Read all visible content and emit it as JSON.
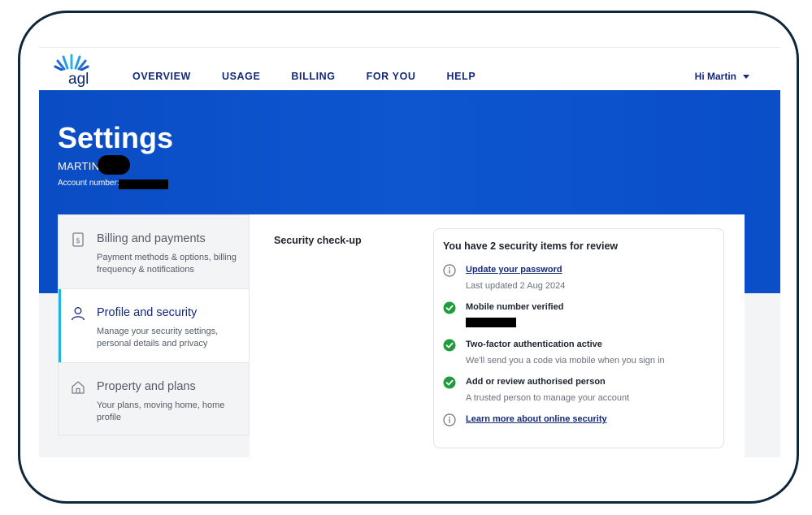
{
  "brand": {
    "name": "agl",
    "accent": "#0a4cc4",
    "highlight": "#23b5d9"
  },
  "nav": {
    "links": [
      "OVERVIEW",
      "USAGE",
      "BILLING",
      "FOR YOU",
      "HELP"
    ],
    "user_greeting": "Hi Martin"
  },
  "header": {
    "title": "Settings",
    "customer_name": "MARTIN",
    "account_label": "Account number:"
  },
  "sidebar": {
    "items": [
      {
        "title": "Billing and payments",
        "description": "Payment methods & options, billing frequency & notifications",
        "icon": "dollar-document-icon",
        "selected": false
      },
      {
        "title": "Profile and security",
        "description": "Manage your security settings, personal details and privacy",
        "icon": "person-icon",
        "selected": true
      },
      {
        "title": "Property and plans",
        "description": "Your plans, moving home, home profile",
        "icon": "house-icon",
        "selected": false
      }
    ]
  },
  "main": {
    "section_label": "Security check-up",
    "card_title": "You have 2 security items for review",
    "items": [
      {
        "icon": "info-icon",
        "title": "Update your password",
        "subtitle": "Last updated 2 Aug 2024",
        "link": true
      },
      {
        "icon": "check-circle-icon",
        "title": "Mobile number verified",
        "subtitle": "",
        "link": false
      },
      {
        "icon": "check-circle-icon",
        "title": "Two-factor authentication active",
        "subtitle": "We'll send you a code via mobile when you sign in",
        "link": false
      },
      {
        "icon": "check-circle-icon",
        "title": "Add or review authorised person",
        "subtitle": "A trusted person to manage your account",
        "link": false
      },
      {
        "icon": "info-icon",
        "title": "Learn more about online security",
        "subtitle": "",
        "link": true
      }
    ]
  }
}
